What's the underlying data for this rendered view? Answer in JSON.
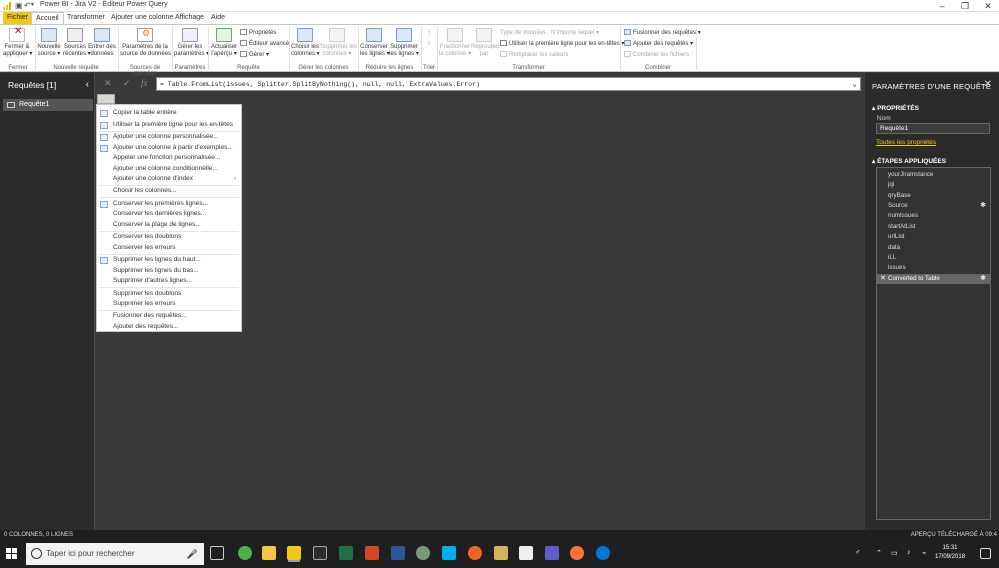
{
  "titlebar": {
    "title": "Power BI - Jira V2 - Éditeur Power Query",
    "icons": [
      "powerbi-logo",
      "save-icon",
      "undo-icon",
      "quick-access-dropdown"
    ],
    "window_controls": [
      "–",
      "❐",
      "✕"
    ]
  },
  "tabs": [
    "Fichier",
    "Accueil",
    "Transformer",
    "Ajouter une colonne",
    "Affichage",
    "Aide"
  ],
  "ribbon": {
    "fermer_appliquer": "Fermer &\nappliquer ▾",
    "nouvelle_source": "Nouvelle\nsource ▾",
    "sources_recentes": "Sources\nrécentes ▾",
    "entrer_donnees": "Entrer des\ndonnées",
    "parametres_source": "Paramètres de la\nsource de données",
    "gerer_parametres": "Gérer les\nparamètres ▾",
    "actualiser": "Actualiser\nl'aperçu ▾",
    "proprietes": "Propriétés",
    "editeur_avance": "Éditeur avancé",
    "gerer": "Gérer ▾",
    "choisir_colonnes": "Choisir les\ncolonnes ▾",
    "supprimer_colonnes": "Supprimer les\ncolonnes ▾",
    "conserver_lignes": "Conserver\nles lignes ▾",
    "supprimer_lignes": "Supprimer\nles lignes ▾",
    "fractionner": "Fractionner\nla colonne ▾",
    "regrouper": "Regrouper\npar",
    "type_donnees": "Type de données : N'importe lequel ▾",
    "premiere_ligne": "Utiliser la première ligne pour les en-têtes ▾",
    "remplacer": "Remplacer les valeurs",
    "fusionner": "Fusionner des requêtes ▾",
    "ajouter_requetes": "Ajouter des requêtes ▾",
    "combiner_fichiers": "Combiner les fichiers",
    "groups": [
      "Fermer",
      "Nouvelle requête",
      "Sources de données",
      "Paramètres",
      "Requête",
      "Gérer les colonnes",
      "Réduire les lignes",
      "Trier",
      "Transformer",
      "Combiner"
    ]
  },
  "left_pane": {
    "header": "Requêtes [1]",
    "collapse": "‹",
    "items": [
      "Requête1"
    ]
  },
  "formula_bar": {
    "cancel": "✕",
    "commit": "✓",
    "fx": "fx",
    "formula": "= Table.FromList(issues, Splitter.SplitByNothing(), null, null, ExtraValues.Error)",
    "dropdown": "⌄"
  },
  "context_menu": {
    "items": [
      "Copier la table entière",
      "Utiliser la première ligne pour les en-têtes",
      "Ajouter une colonne personnalisée...",
      "Ajouter une colonne à partir d'exemples...",
      "Appeler une fonction personnalisée...",
      "Ajouter une colonne conditionnelle...",
      "Ajouter une colonne d'index",
      "Choisir les colonnes...",
      "Conserver les premières lignes...",
      "Conserver les dernières lignes...",
      "Conserver la plage de lignes...",
      "Conserver les doublons",
      "Conserver les erreurs",
      "Supprimer les lignes du haut...",
      "Supprimer les lignes du bas...",
      "Supprimer d'autres lignes...",
      "Supprimer les doublons",
      "Supprimer les erreurs",
      "Fusionner des requêtes...",
      "Ajouter des requêtes..."
    ]
  },
  "right_pane": {
    "header": "PARAMÈTRES D'UNE REQUÊTE",
    "close": "✕",
    "properties_title": "PROPRIÉTÉS",
    "name_label": "Nom",
    "name_value": "Requête1",
    "all_properties": "Toutes les propriétés",
    "steps_title": "ÉTAPES APPLIQUÉES",
    "steps": [
      "yourJiraInstance",
      "jql",
      "qryBase",
      "Source",
      "numIssues",
      "startAtList",
      "urlList",
      "data",
      "iLL",
      "issues",
      "Converted to Table"
    ],
    "gear": "✱"
  },
  "status": {
    "left": "0 COLONNES, 0 LIGNES",
    "right": "APERÇU TÉLÉCHARGÉ À 09:4"
  },
  "taskbar": {
    "search_placeholder": "Taper ici pour rechercher",
    "mic": "🎤",
    "time": "15:31",
    "date": "17/09/2018"
  }
}
